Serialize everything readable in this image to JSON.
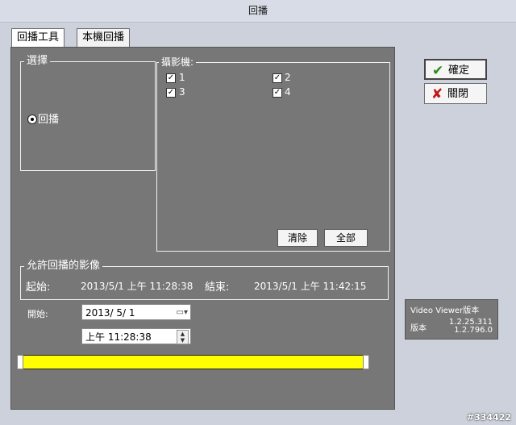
{
  "window": {
    "title": "回播"
  },
  "tabs": [
    {
      "label": "回播工具"
    },
    {
      "label": "本機回播"
    }
  ],
  "select_group": {
    "label": "選擇",
    "radio_label": "回播"
  },
  "camera_group": {
    "label": "攝影機:",
    "cameras": [
      {
        "label": "1",
        "checked": true
      },
      {
        "label": "2",
        "checked": true
      },
      {
        "label": "3",
        "checked": true
      },
      {
        "label": "4",
        "checked": true
      }
    ],
    "clear_label": "清除",
    "all_label": "全部"
  },
  "allowed_group": {
    "label": "允許回播的影像",
    "start_label": "起始:",
    "start_value": "2013/5/1 上午 11:28:38",
    "end_label": "結束:",
    "end_value": "2013/5/1 上午 11:42:15"
  },
  "start_section": {
    "label": "開始:",
    "date_value": "2013/  5/  1",
    "time_value": "上午 11:28:38"
  },
  "timeline": {
    "position": 0.0,
    "fill_color": "#ffff00"
  },
  "buttons": {
    "ok_label": "確定",
    "close_label": "關閉"
  },
  "version_box": {
    "title": "Video Viewer版本",
    "version_label": "版本",
    "version_1": "1.2.25.311",
    "version_2": "1.2.796.0"
  },
  "watermark": "#334422"
}
